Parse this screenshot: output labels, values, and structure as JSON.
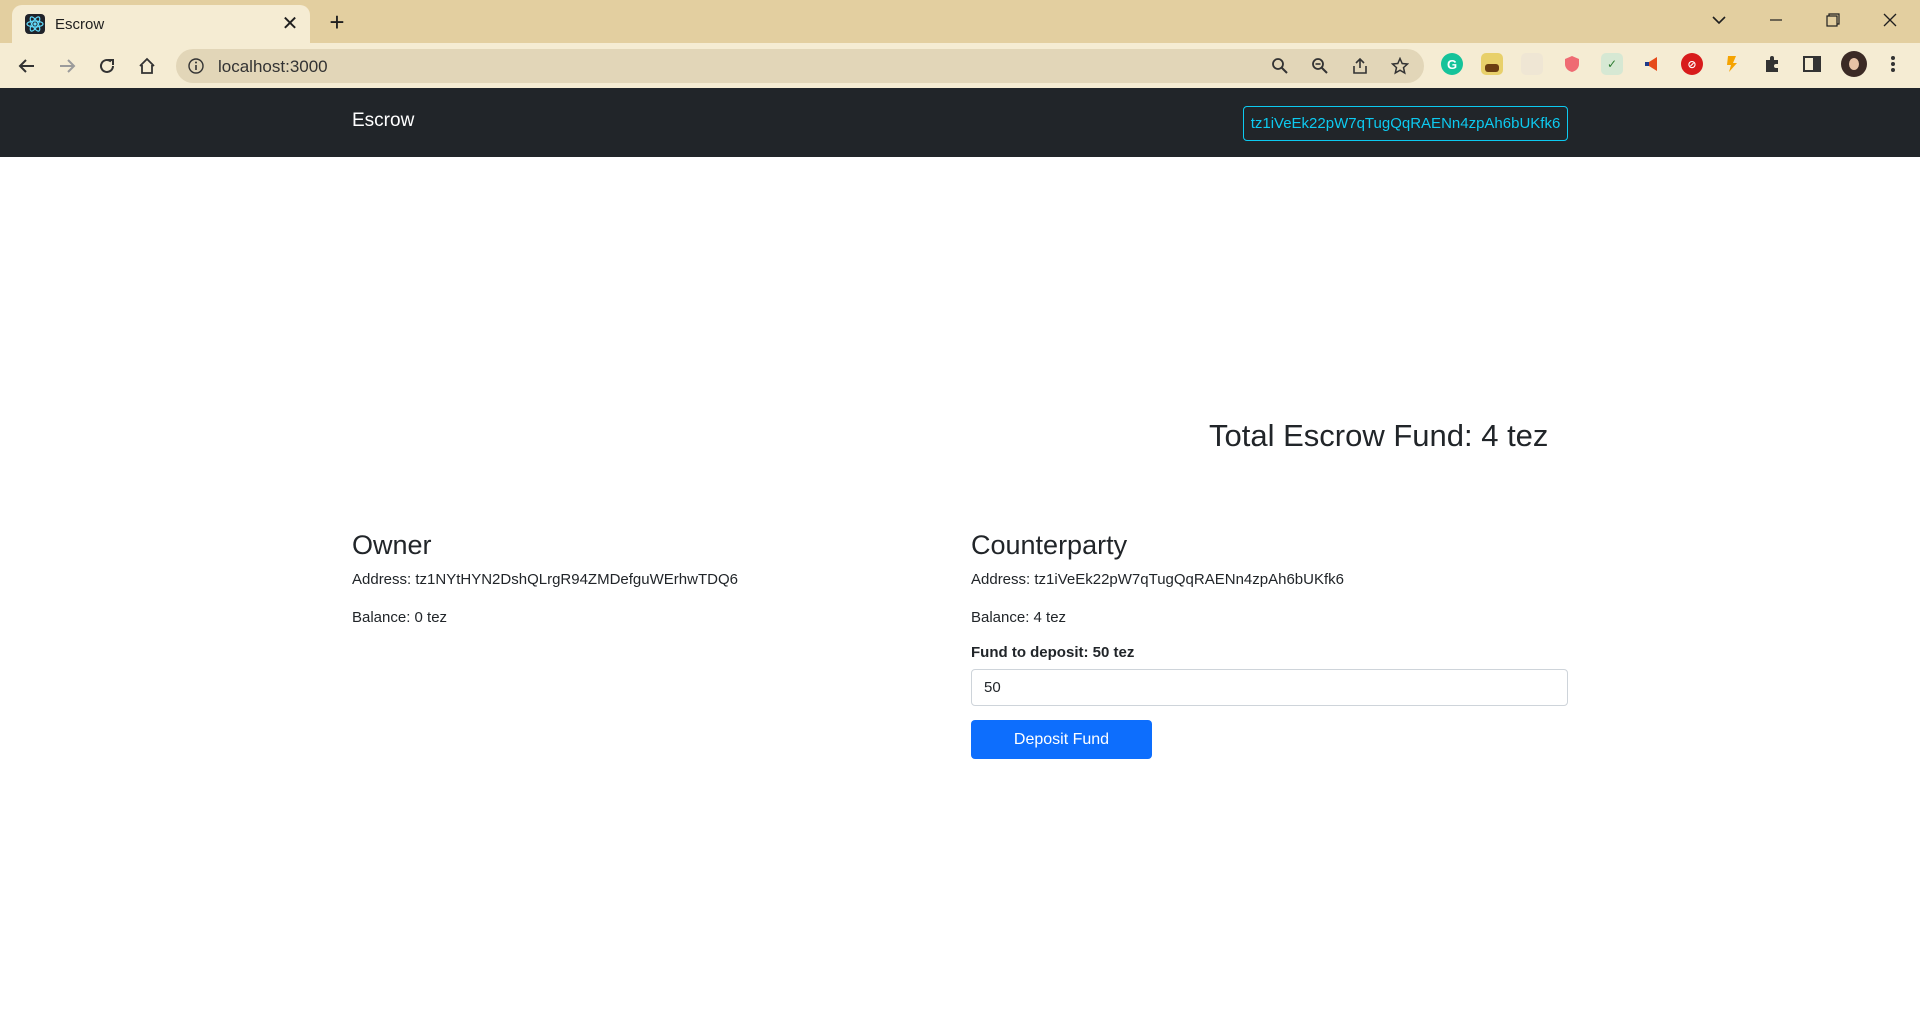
{
  "browser": {
    "tab_title": "Escrow",
    "url": "localhost:3000"
  },
  "navbar": {
    "brand": "Escrow",
    "wallet_address": "tz1iVeEk22pW7qTugQqRAENn4zpAh6bUKfk6"
  },
  "total_fund": "Total Escrow Fund: 4 tez",
  "owner": {
    "title": "Owner",
    "address": "Address: tz1NYtHYN2DshQLrgR94ZMDefguWErhwTDQ6",
    "balance": "Balance: 0 tez"
  },
  "counterparty": {
    "title": "Counterparty",
    "address": "Address: tz1iVeEk22pW7qTugQqRAENn4zpAh6bUKfk6",
    "balance": "Balance: 4 tez",
    "fund_label": "Fund to deposit: 50 tez",
    "fund_value": "50",
    "deposit_button": "Deposit Fund"
  },
  "colors": {
    "navbar_bg": "#212529",
    "wallet_outline": "#0dcaf0",
    "primary_button": "#0d6efd",
    "browser_frame": "#e3cfa0"
  }
}
